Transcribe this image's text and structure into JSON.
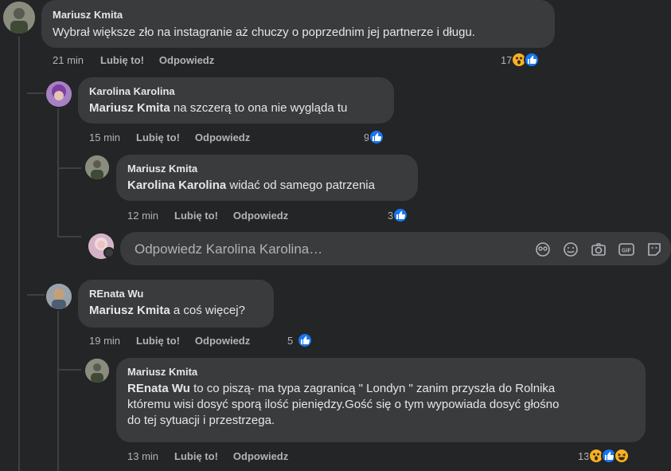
{
  "comments": [
    {
      "author": "Mariusz Kmita",
      "text": "Wybrał większe zło na instagranie aż chuczy o poprzednim jej partnerze i długu.",
      "time": "21 min",
      "like_label": "Lubię to!",
      "reply_label": "Odpowiedz",
      "reaction_count": "17",
      "reactions": [
        "wow-icon",
        "like-icon"
      ]
    },
    {
      "author": "Karolina Karolina",
      "mention": "Mariusz Kmita",
      "text": " na szczerą to ona nie wygląda tu",
      "time": "15 min",
      "like_label": "Lubię to!",
      "reply_label": "Odpowiedz",
      "reaction_count": "9",
      "reactions": [
        "like-icon"
      ]
    },
    {
      "author": "Mariusz Kmita",
      "mention": "Karolina Karolina",
      "text": " widać od samego patrzenia",
      "time": "12 min",
      "like_label": "Lubię to!",
      "reply_label": "Odpowiedz",
      "reaction_count": "3",
      "reactions": [
        "like-icon"
      ]
    },
    {
      "author": "REnata Wu",
      "mention": "Mariusz Kmita",
      "text": " a coś więcej?",
      "time": "19 min",
      "like_label": "Lubię to!",
      "reply_label": "Odpowiedz",
      "reaction_count": "5",
      "reactions": [
        "like-icon"
      ]
    },
    {
      "author": "Mariusz Kmita",
      "mention": "REnata Wu",
      "text_line1": " to co piszą- ma typa zagranicą \" Londyn \" zanim przyszła do Rolnika",
      "text_line2": "któremu wisi dosyć sporą ilość pieniędzy.Gość się o tym wypowiada dosyć głośno",
      "text_line3": "do tej sytuacji i przestrzega.",
      "time": "13 min",
      "like_label": "Lubię to!",
      "reply_label": "Odpowiedz",
      "reaction_count": "13",
      "reactions": [
        "wow-icon",
        "like-icon",
        "haha-icon"
      ]
    }
  ],
  "reply_input": {
    "placeholder": "Odpowiedz Karolina Karolina…",
    "tools": [
      "avatar-sticker-icon",
      "emoji-icon",
      "camera-icon",
      "gif-icon",
      "sticker-icon"
    ]
  },
  "colors": {
    "background": "#242526",
    "bubble": "#3a3b3c",
    "text": "#e4e6eb",
    "secondary_text": "#b0b3b8",
    "like_blue": "#1877f2",
    "emoji_yellow": "#f7b125"
  }
}
